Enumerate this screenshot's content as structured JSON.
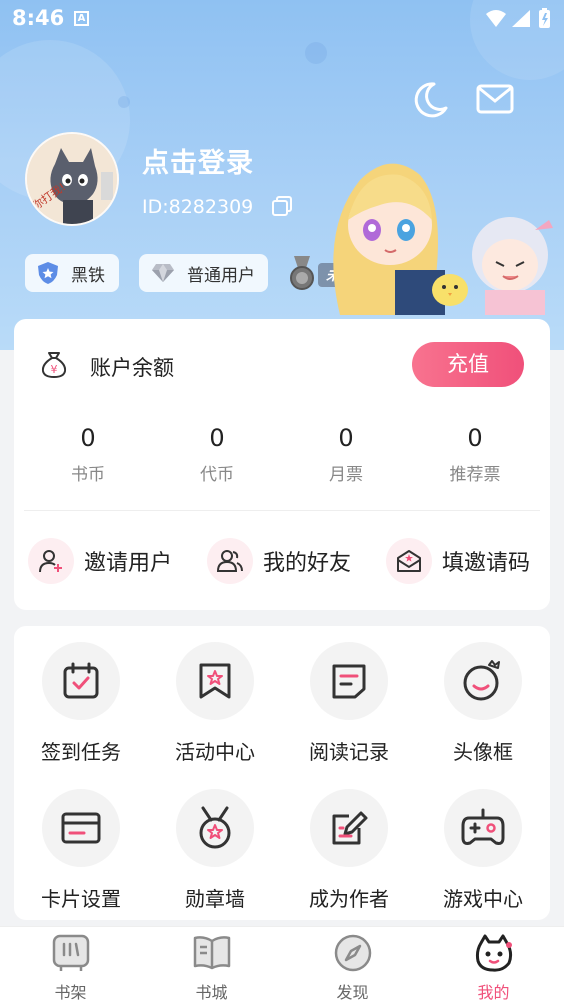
{
  "status_bar": {
    "time": "8:46",
    "notif_letter": "A"
  },
  "profile": {
    "login_label": "点击登录",
    "user_id": "ID:8282309",
    "badges": [
      {
        "label": "黑铁",
        "icon": "shield-badge-icon"
      },
      {
        "label": "普通用户",
        "icon": "diamond-icon"
      }
    ],
    "membership_status": "未开通"
  },
  "balance": {
    "title": "账户余额",
    "recharge_label": "充值",
    "stats": [
      {
        "value": "0",
        "label": "书币"
      },
      {
        "value": "0",
        "label": "代币"
      },
      {
        "value": "0",
        "label": "月票"
      },
      {
        "value": "0",
        "label": "推荐票"
      }
    ],
    "actions": [
      {
        "label": "邀请用户",
        "icon": "add-user-icon"
      },
      {
        "label": "我的好友",
        "icon": "friends-icon"
      },
      {
        "label": "填邀请码",
        "icon": "envelope-star-icon"
      }
    ]
  },
  "features": [
    {
      "label": "签到任务",
      "icon": "calendar-check-icon"
    },
    {
      "label": "活动中心",
      "icon": "bookmark-star-icon"
    },
    {
      "label": "阅读记录",
      "icon": "document-icon"
    },
    {
      "label": "头像框",
      "icon": "avatar-frame-icon"
    },
    {
      "label": "卡片设置",
      "icon": "card-icon"
    },
    {
      "label": "勋章墙",
      "icon": "medal-icon"
    },
    {
      "label": "成为作者",
      "icon": "edit-icon"
    },
    {
      "label": "游戏中心",
      "icon": "gamepad-icon"
    }
  ],
  "bottom_nav": [
    {
      "label": "书架",
      "icon": "bookshelf-icon"
    },
    {
      "label": "书城",
      "icon": "book-open-icon"
    },
    {
      "label": "发现",
      "icon": "compass-icon"
    },
    {
      "label": "我的",
      "icon": "mascot-icon",
      "active": true
    }
  ],
  "colors": {
    "accent": "#f0507a",
    "header": "#8fc1f2"
  }
}
